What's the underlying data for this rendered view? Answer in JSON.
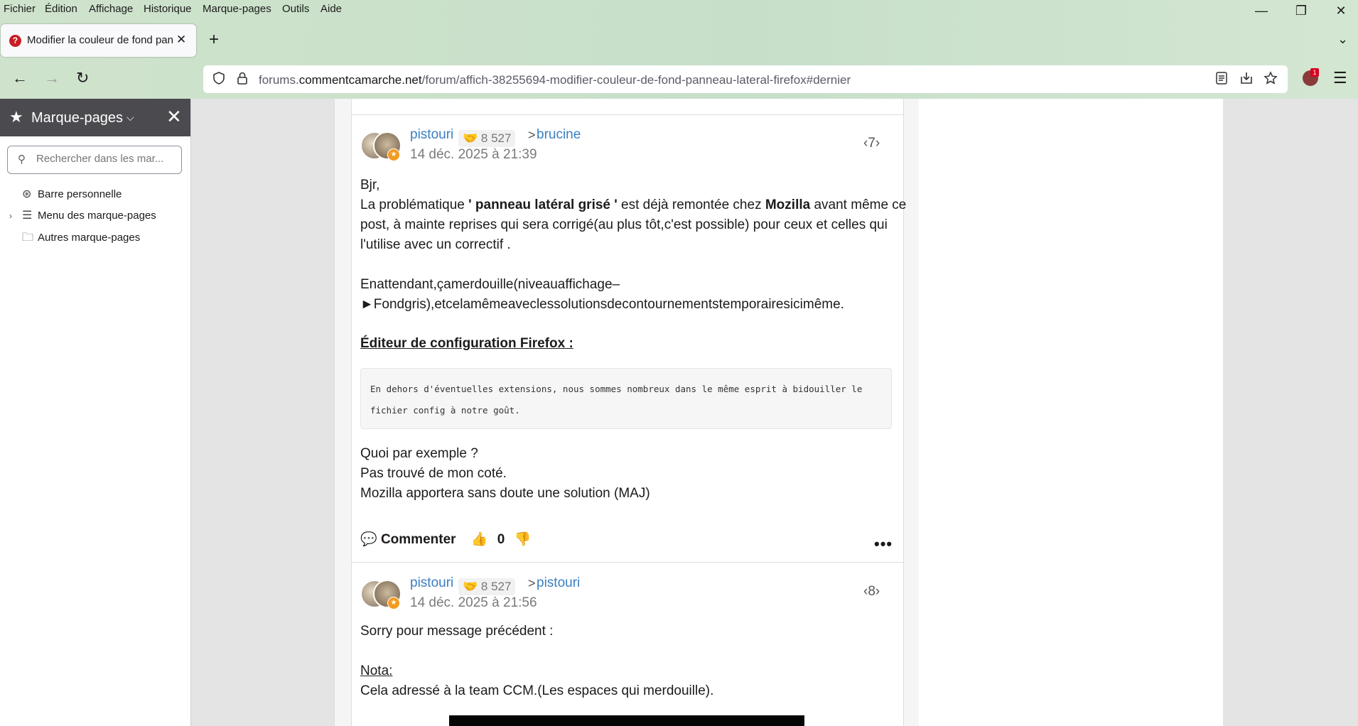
{
  "menubar": {
    "items": [
      "Fichier",
      "Édition",
      "Affichage",
      "Historique",
      "Marque-pages",
      "Outils",
      "Aide"
    ]
  },
  "window": {
    "minimize": "—",
    "restore": "❐",
    "close": "✕"
  },
  "tab": {
    "title": "Modifier la couleur de fond panneau latéral firefox",
    "favicon": "?",
    "close": "✕"
  },
  "toolbar": {
    "new_tab": "+",
    "tab_list": "⌄",
    "back": "←",
    "forward": "→",
    "reload": "↻"
  },
  "urlbar": {
    "prefix": "forums.",
    "domain": "commentcamarche.net",
    "path": "/forum/affich-38255694-modifier-couleur-de-fond-panneau-lateral-firefox#dernier"
  },
  "extension": {
    "badge": "1"
  },
  "sidebar": {
    "title": "Marque-pages",
    "search_placeholder": "Rechercher dans les mar...",
    "items": [
      {
        "label": "Barre personnelle",
        "icon": "star-folder-icon"
      },
      {
        "label": "Menu des marque-pages",
        "icon": "menu-folder-icon",
        "expandable": true
      },
      {
        "label": "Autres marque-pages",
        "icon": "folder-icon"
      }
    ]
  },
  "posts": [
    {
      "author": "pistouri",
      "reputation": "8 527",
      "reply_to": "brucine",
      "date": "14 déc. 2025 à 21:39",
      "number": "7",
      "greeting": "Bjr,",
      "l1_pre": "La problématique ",
      "l1_b1": "' panneau latéral grisé '",
      "l1_mid": " est déjà remontée chez ",
      "l1_b2": "Mozilla",
      "l1_post": " avant même ce",
      "l2": "post, à mainte reprises qui sera corrigé(au plus tôt,c'est possible) pour ceux et celles qui",
      "l3": "l'utilise avec un correctif .",
      "l4": "Enattendant,çamerdouille(niveauaffichage–",
      "l5": "►Fondgris),etcelamêmeaveclessolutionsdecontournementstemporairesicimême.",
      "heading": "Éditeur de configuration Firefox :",
      "code": "En dehors d'éventuelles extensions, nous sommes nombreux dans le même esprit à bidouiller le fichier config à notre goût.",
      "l6": "Quoi par exemple ?",
      "l7": "Pas trouvé de mon coté.",
      "l8": "Mozilla apportera sans doute une solution (MAJ)",
      "comment_label": "Commenter",
      "votes": "0"
    },
    {
      "author": "pistouri",
      "reputation": "8 527",
      "reply_to": "pistouri",
      "date": "14 déc. 2025 à 21:56",
      "number": "8",
      "l1": "Sorry pour message précédent :",
      "nota": "Nota:",
      "l2": "Cela adressé à la team CCM.(Les espaces qui merdouille)."
    }
  ]
}
